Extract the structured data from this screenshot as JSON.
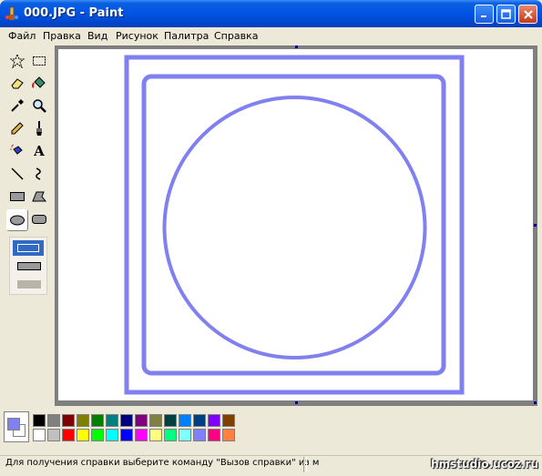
{
  "window": {
    "title": "000.JPG - Paint"
  },
  "menu": [
    "Файл",
    "Правка",
    "Вид",
    "Рисунок",
    "Палитра",
    "Справка"
  ],
  "tools": [
    {
      "name": "free-form-select-tool",
      "icon": "star-select-icon"
    },
    {
      "name": "rect-select-tool",
      "icon": "rect-select-icon"
    },
    {
      "name": "eraser-tool",
      "icon": "eraser-icon"
    },
    {
      "name": "fill-tool",
      "icon": "paint-bucket-icon"
    },
    {
      "name": "pick-color-tool",
      "icon": "eyedropper-icon"
    },
    {
      "name": "magnifier-tool",
      "icon": "magnifier-icon"
    },
    {
      "name": "pencil-tool",
      "icon": "pencil-icon"
    },
    {
      "name": "brush-tool",
      "icon": "brush-icon"
    },
    {
      "name": "airbrush-tool",
      "icon": "airbrush-icon"
    },
    {
      "name": "text-tool",
      "icon": "text-icon",
      "glyph": "A"
    },
    {
      "name": "line-tool",
      "icon": "line-icon"
    },
    {
      "name": "curve-tool",
      "icon": "curve-icon"
    },
    {
      "name": "rectangle-tool",
      "icon": "rectangle-icon"
    },
    {
      "name": "polygon-tool",
      "icon": "polygon-icon"
    },
    {
      "name": "ellipse-tool",
      "icon": "ellipse-icon",
      "selected": true
    },
    {
      "name": "rounded-rect-tool",
      "icon": "rounded-rect-icon"
    }
  ],
  "drawing_color": "#8080f0",
  "palette": {
    "foreground": "#8080f0",
    "background": "#ffffff",
    "row1": [
      "#000000",
      "#808080",
      "#800000",
      "#808000",
      "#008000",
      "#008080",
      "#000080",
      "#800080",
      "#808040",
      "#004040",
      "#0080ff",
      "#004080",
      "#8000ff",
      "#804000"
    ],
    "row2": [
      "#ffffff",
      "#c0c0c0",
      "#ff0000",
      "#ffff00",
      "#00ff00",
      "#00ffff",
      "#0000ff",
      "#ff00ff",
      "#ffff80",
      "#00ff80",
      "#80ffff",
      "#8080ff",
      "#ff0080",
      "#ff8040"
    ]
  },
  "status": {
    "help_text": "Для получения справки выберите команду \"Вызов справки\" из м",
    "watermark": "hmstudio.ucoz.ru"
  }
}
